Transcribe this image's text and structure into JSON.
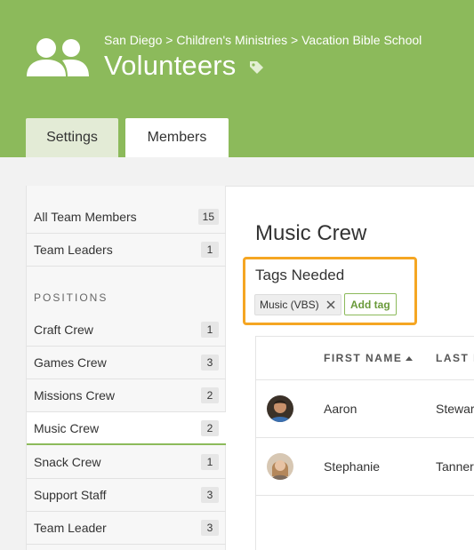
{
  "header": {
    "breadcrumb": "San Diego > Children's Ministries > Vacation Bible School",
    "title": "Volunteers",
    "icon": "team-icon",
    "title_icon": "tag-icon",
    "bg_color": "#8cba5b"
  },
  "tabs": [
    {
      "label": "Settings",
      "active": false
    },
    {
      "label": "Members",
      "active": true
    }
  ],
  "sidebar": {
    "top_items": [
      {
        "label": "All Team Members",
        "count": "15"
      },
      {
        "label": "Team Leaders",
        "count": "1"
      }
    ],
    "positions_heading": "POSITIONS",
    "positions": [
      {
        "label": "Craft Crew",
        "count": "1",
        "active": false
      },
      {
        "label": "Games Crew",
        "count": "3",
        "active": false
      },
      {
        "label": "Missions Crew",
        "count": "2",
        "active": false
      },
      {
        "label": "Music Crew",
        "count": "2",
        "active": true
      },
      {
        "label": "Snack Crew",
        "count": "1",
        "active": false
      },
      {
        "label": "Support Staff",
        "count": "3",
        "active": false
      },
      {
        "label": "Team Leader",
        "count": "3",
        "active": false
      }
    ]
  },
  "main": {
    "section_title": "Music Crew",
    "tags_heading": "Tags Needed",
    "tag_chip": "Music (VBS)",
    "add_tag_label": "Add tag",
    "highlight_color": "#f5a623"
  },
  "table": {
    "columns": [
      "FIRST NAME",
      "LAST N"
    ],
    "rows": [
      {
        "first": "Aaron",
        "last": "Stewar"
      },
      {
        "first": "Stephanie",
        "last": "Tanner"
      }
    ]
  }
}
